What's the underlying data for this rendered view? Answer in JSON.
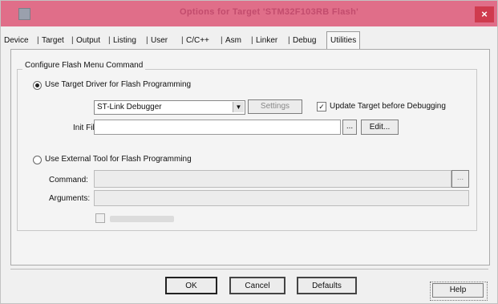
{
  "window": {
    "title": "Options for Target 'STM32F103RB Flash'",
    "close_glyph": "×"
  },
  "tabs": [
    {
      "label": "Device",
      "active": false
    },
    {
      "label": "Target",
      "active": false
    },
    {
      "label": "Output",
      "active": false
    },
    {
      "label": "Listing",
      "active": false
    },
    {
      "label": "User",
      "active": false
    },
    {
      "label": "C/C++",
      "active": false
    },
    {
      "label": "Asm",
      "active": false
    },
    {
      "label": "Linker",
      "active": false
    },
    {
      "label": "Debug",
      "active": false
    },
    {
      "label": "Utilities",
      "active": true
    }
  ],
  "flash": {
    "group_title": "Configure Flash Menu Command",
    "use_target_driver_label": "Use Target Driver for Flash Programming",
    "use_target_driver_selected": true,
    "driver_select_value": "ST-Link Debugger",
    "settings_label": "Settings",
    "update_target_label": "Update Target before Debugging",
    "update_target_checked": true,
    "init_file_label": "Init File:",
    "init_file_value": "",
    "browse_label": "...",
    "edit_label": "Edit...",
    "use_external_tool_label": "Use External Tool for Flash Programming",
    "use_external_tool_selected": false,
    "command_label": "Command:",
    "command_value": "",
    "command_browse_label": "...",
    "arguments_label": "Arguments:",
    "arguments_value": "",
    "run_independent_checked": false
  },
  "footer": {
    "ok_label": "OK",
    "cancel_label": "Cancel",
    "defaults_label": "Defaults",
    "help_label": "Help"
  },
  "colors": {
    "titlebar": "#e06e89",
    "close": "#cf3b4e",
    "dialog_bg": "#f0f0f0"
  }
}
